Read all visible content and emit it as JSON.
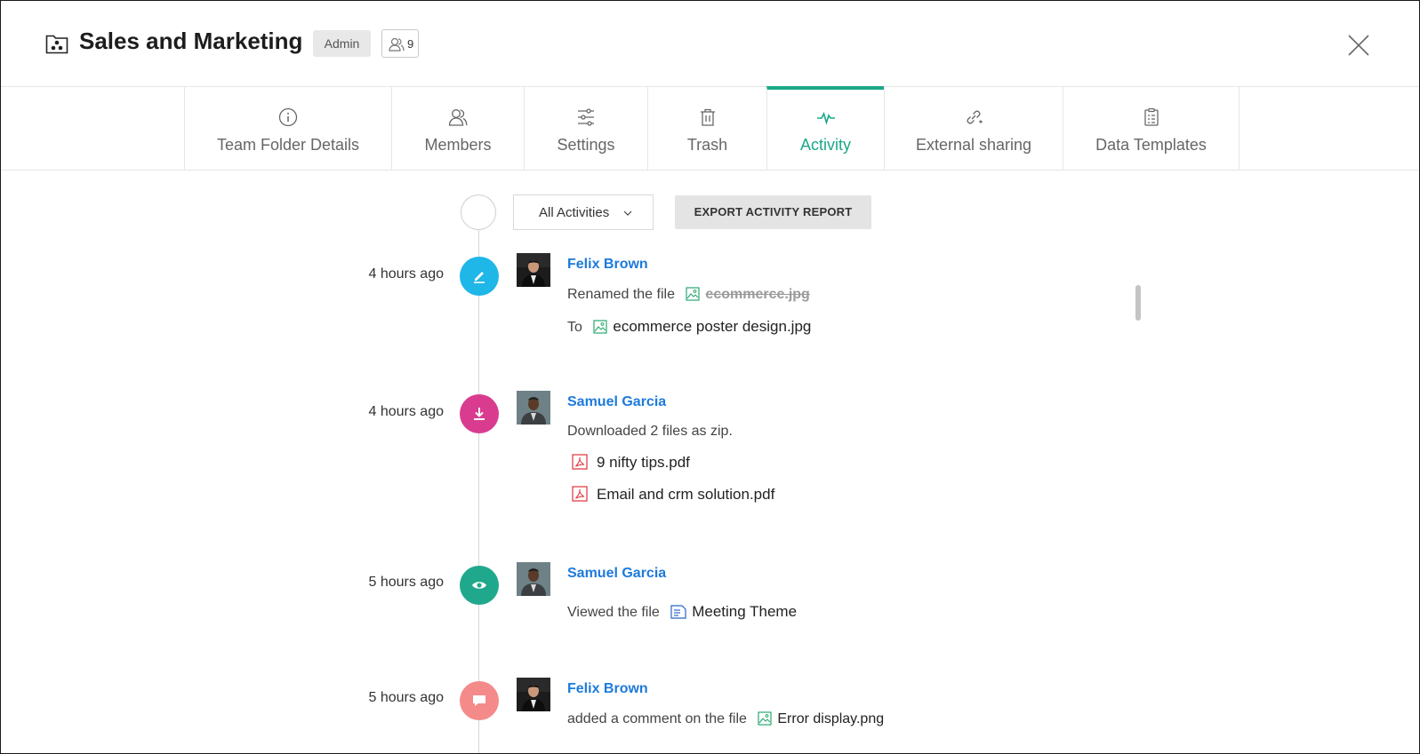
{
  "header": {
    "title": "Sales and Marketing",
    "role_badge": "Admin",
    "members_count": "9"
  },
  "tabs": [
    {
      "label": "Team Folder Details",
      "icon": "info-icon"
    },
    {
      "label": "Members",
      "icon": "members-icon"
    },
    {
      "label": "Settings",
      "icon": "sliders-icon"
    },
    {
      "label": "Trash",
      "icon": "trash-icon"
    },
    {
      "label": "Activity",
      "icon": "pulse-icon",
      "active": true
    },
    {
      "label": "External sharing",
      "icon": "link-icon"
    },
    {
      "label": "Data Templates",
      "icon": "template-icon"
    }
  ],
  "toolbar": {
    "filter_label": "All Activities",
    "export_label": "EXPORT ACTIVITY REPORT"
  },
  "activities": [
    {
      "time": "4 hours ago",
      "user": "Felix Brown",
      "type": "rename",
      "action": "Renamed the file",
      "old_name": "ecommerce.jpg",
      "to_label": "To",
      "new_name": "ecommerce poster design.jpg",
      "color": "#1fb6e8"
    },
    {
      "time": "4 hours ago",
      "user": "Samuel Garcia",
      "type": "download",
      "action": "Downloaded 2 files as zip.",
      "files": [
        "9 nifty tips.pdf",
        "Email and crm solution.pdf"
      ],
      "color": "#d93c8f"
    },
    {
      "time": "5 hours ago",
      "user": "Samuel Garcia",
      "type": "view",
      "action": "Viewed the file",
      "file": "Meeting Theme",
      "color": "#20a88c"
    },
    {
      "time": "5 hours ago",
      "user": "Felix Brown",
      "type": "comment",
      "action": "added a comment on the file",
      "file": "Error display.png",
      "color": "#f58a8a"
    }
  ],
  "colors": {
    "accent": "#1aa889",
    "link": "#1d7adb"
  }
}
